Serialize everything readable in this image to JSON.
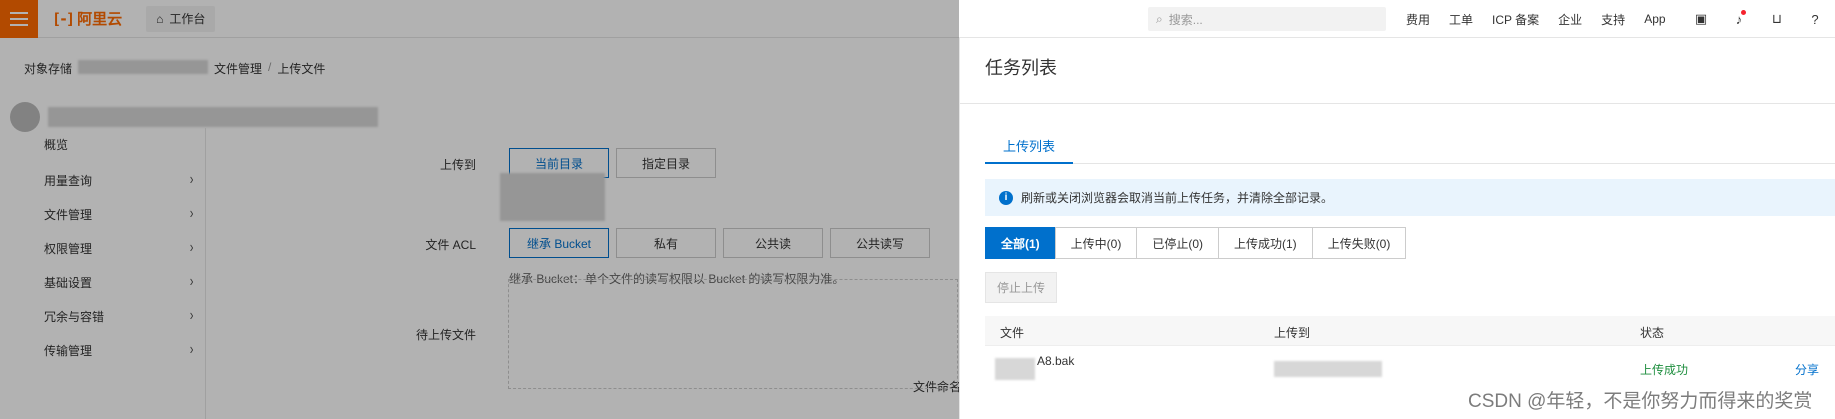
{
  "topbar": {
    "brand": "阿里云",
    "brand_mark": "[-]",
    "workbench": "工作台",
    "search_placeholder": "搜索...",
    "links": [
      "费用",
      "工单",
      "ICP 备案",
      "企业",
      "支持",
      "App"
    ],
    "accent": "#ff6a00"
  },
  "breadcrumb": {
    "root": "对象存储",
    "file_mgmt": "文件管理",
    "current": "上传文件"
  },
  "sidebar": {
    "items": [
      {
        "label": "概览"
      },
      {
        "label": "用量查询"
      },
      {
        "label": "文件管理"
      },
      {
        "label": "权限管理"
      },
      {
        "label": "基础设置"
      },
      {
        "label": "冗余与容错"
      },
      {
        "label": "传输管理"
      }
    ]
  },
  "form": {
    "upload_to_label": "上传到",
    "current_dir": "当前目录",
    "specified_dir": "指定目录",
    "acl_label": "文件 ACL",
    "acl_options": [
      "继承 Bucket",
      "私有",
      "公共读",
      "公共读写"
    ],
    "acl_hint": "继承 Bucket：单个文件的读写权限以 Bucket 的读写权限为准。",
    "pending_label": "待上传文件",
    "file_naming": "文件命名"
  },
  "drawer": {
    "title": "任务列表",
    "tab": "上传列表",
    "notice": "刷新或关闭浏览器会取消当前上传任务，并清除全部记录。",
    "filters": [
      "全部(1)",
      "上传中(0)",
      "已停止(0)",
      "上传成功(1)",
      "上传失败(0)"
    ],
    "stop_button": "停止上传",
    "columns": [
      "文件",
      "上传到",
      "状态"
    ],
    "rows": [
      {
        "file": "A8.bak",
        "status": "上传成功",
        "action": "分享"
      }
    ],
    "primary_color": "#0070cc",
    "success_color": "#1e8e3e"
  },
  "watermark": "CSDN @年轻，不是你努力而得来的奖赏"
}
